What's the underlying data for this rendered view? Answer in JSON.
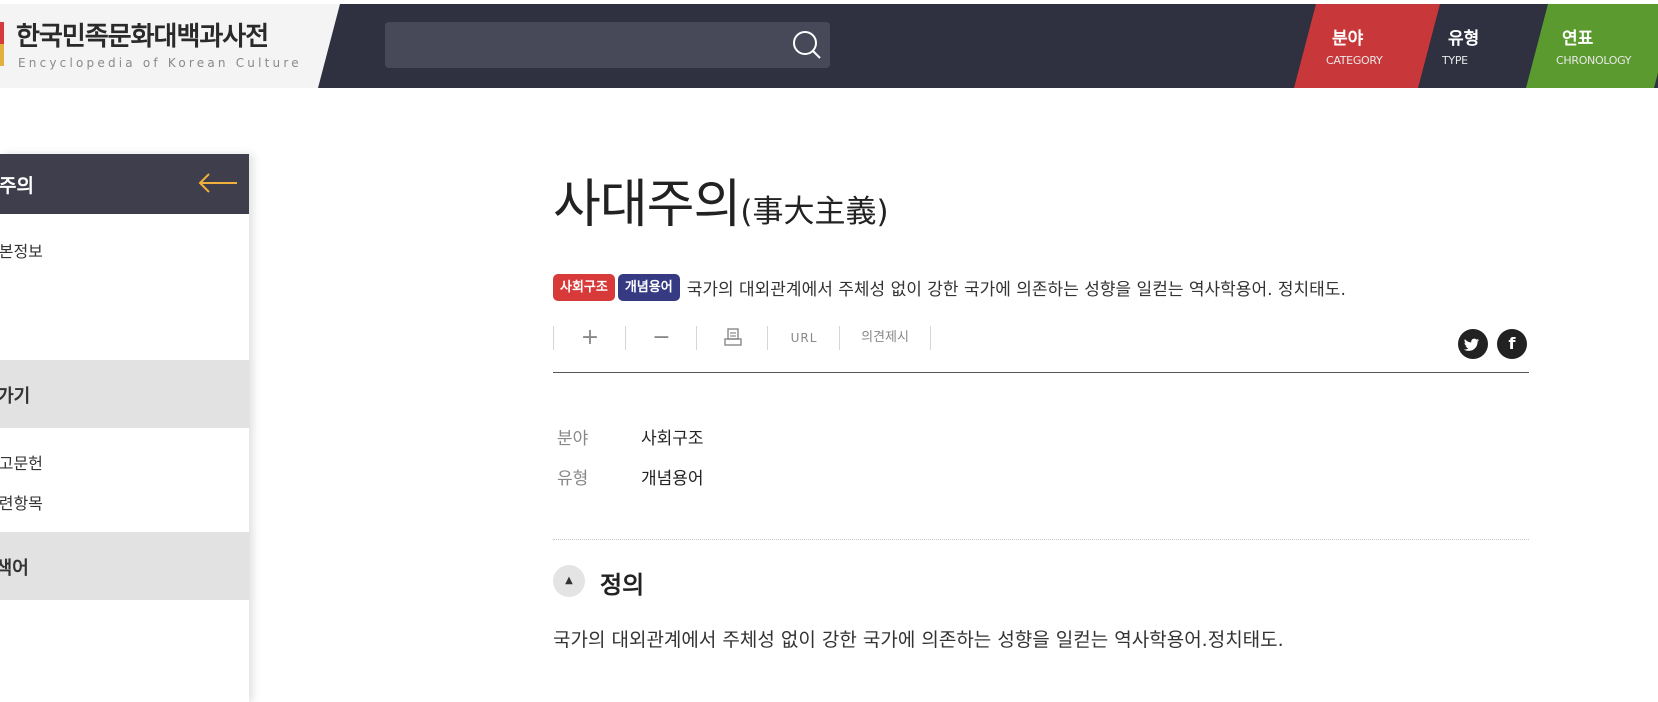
{
  "header": {
    "logo_title": "한국민족문화대백과사전",
    "logo_subtitle": "Encyclopedia of Korean Culture",
    "search": {
      "value": "",
      "placeholder": ""
    },
    "nav": [
      {
        "ko": "분야",
        "en": "CATEGORY",
        "color": "#c8383a"
      },
      {
        "ko": "유형",
        "en": "TYPE"
      },
      {
        "ko": "연표",
        "en": "CHRONOLOGY",
        "color": "#5b9a2e"
      }
    ]
  },
  "sidebar": {
    "title": "사대주의",
    "items": [
      "기본정보"
    ],
    "sections": [
      {
        "label": "바로가기",
        "items": [
          "참고문헌",
          "관련항목"
        ]
      },
      {
        "label": "관련검색어",
        "items": []
      }
    ]
  },
  "entry": {
    "title": "사대주의",
    "hanja": "(事大主義)",
    "tags": [
      {
        "label": "사회구조",
        "color": "#d83a3a"
      },
      {
        "label": "개념용어",
        "color": "#353a82"
      }
    ],
    "summary": "국가의 대외관계에서 주체성 없이 강한 국가에 의존하는 성향을 일컫는 역사학용어.   정치태도.",
    "toolbar": {
      "plus": "+",
      "minus": "−",
      "url": "URL",
      "opinion": "의견제시"
    },
    "meta": [
      {
        "label": "분야",
        "value": "사회구조"
      },
      {
        "label": "유형",
        "value": "개념용어"
      }
    ],
    "sections": [
      {
        "toggle": "▲",
        "title": "정의",
        "text": "국가의 대외관계에서 주체성 없이 강한 국가에 의존하는 성향을 일컫는 역사학용어.정치태도."
      }
    ]
  },
  "icons": {
    "search": "search-icon",
    "back": "arrow-left-icon",
    "print": "print-icon",
    "twitter": "twitter-icon",
    "facebook": "facebook-icon"
  }
}
